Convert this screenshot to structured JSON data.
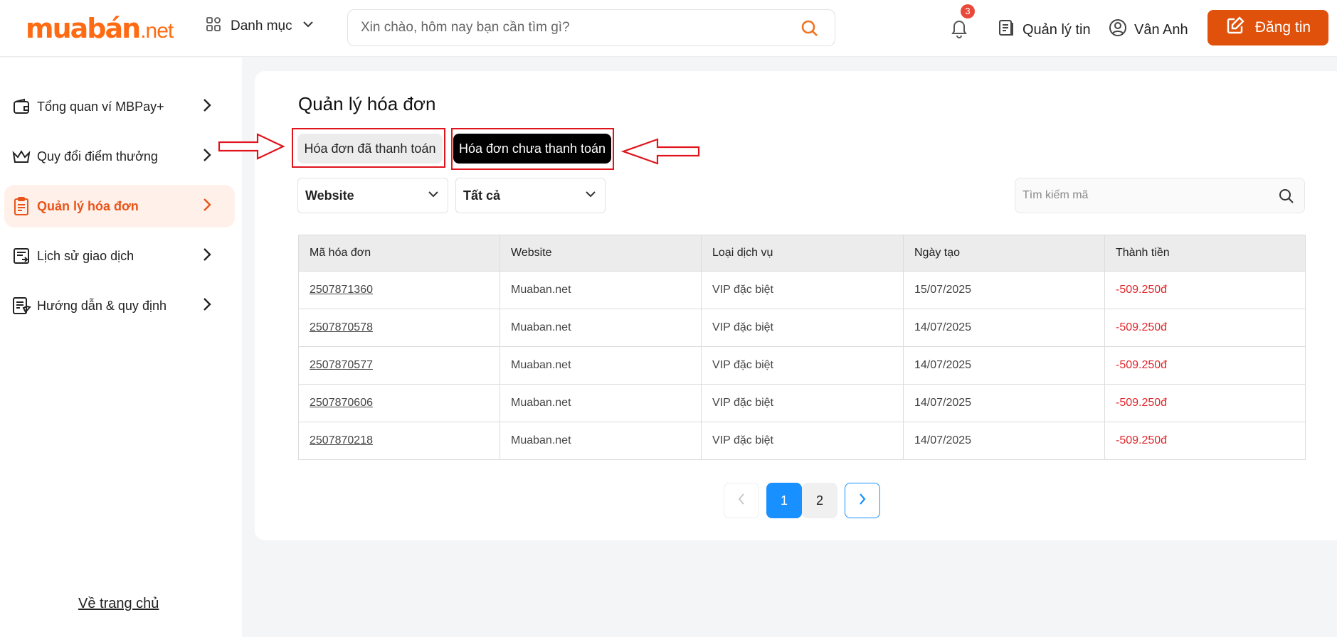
{
  "header": {
    "logo_brand": "muabán",
    "logo_tld": ".net",
    "category_label": "Danh mục",
    "search_placeholder": "Xin chào, hôm nay bạn cần tìm gì?",
    "notification_count": "3",
    "manage_posts_label": "Quản lý tin",
    "user_name": "Vân Anh",
    "post_button_label": "Đăng tin",
    "accent_color": "#e0520b"
  },
  "sidebar": {
    "items": [
      {
        "label": "Tổng quan ví MBPay+",
        "icon": "wallet-icon"
      },
      {
        "label": "Quy đổi điểm thưởng",
        "icon": "crown-icon"
      },
      {
        "label": "Quản lý hóa đơn",
        "icon": "clipboard-icon",
        "active": true
      },
      {
        "label": "Lịch sử giao dịch",
        "icon": "history-icon"
      },
      {
        "label": "Hướng dẫn & quy định",
        "icon": "guide-icon"
      }
    ],
    "home_link": "Về trang chủ"
  },
  "main": {
    "title": "Quản lý hóa đơn",
    "tabs": [
      {
        "label": "Hóa đơn đã thanh toán",
        "active": false
      },
      {
        "label": "Hóa đơn chưa thanh toán",
        "active": true
      }
    ],
    "filters": {
      "website": "Website",
      "status": "Tất cả"
    },
    "code_search_placeholder": "Tìm kiếm mã",
    "table": {
      "columns": [
        "Mã hóa đơn",
        "Website",
        "Loại dịch vụ",
        "Ngày tạo",
        "Thành tiền"
      ],
      "rows": [
        [
          "2507871360",
          "Muaban.net",
          "VIP đặc biệt",
          "15/07/2025",
          "-509.250đ"
        ],
        [
          "2507870578",
          "Muaban.net",
          "VIP đặc biệt",
          "14/07/2025",
          "-509.250đ"
        ],
        [
          "2507870577",
          "Muaban.net",
          "VIP đặc biệt",
          "14/07/2025",
          "-509.250đ"
        ],
        [
          "2507870606",
          "Muaban.net",
          "VIP đặc biệt",
          "14/07/2025",
          "-509.250đ"
        ],
        [
          "2507870218",
          "Muaban.net",
          "VIP đặc biệt",
          "14/07/2025",
          "-509.250đ"
        ]
      ]
    },
    "pagination": {
      "pages": [
        "1",
        "2"
      ],
      "current": "1"
    }
  }
}
